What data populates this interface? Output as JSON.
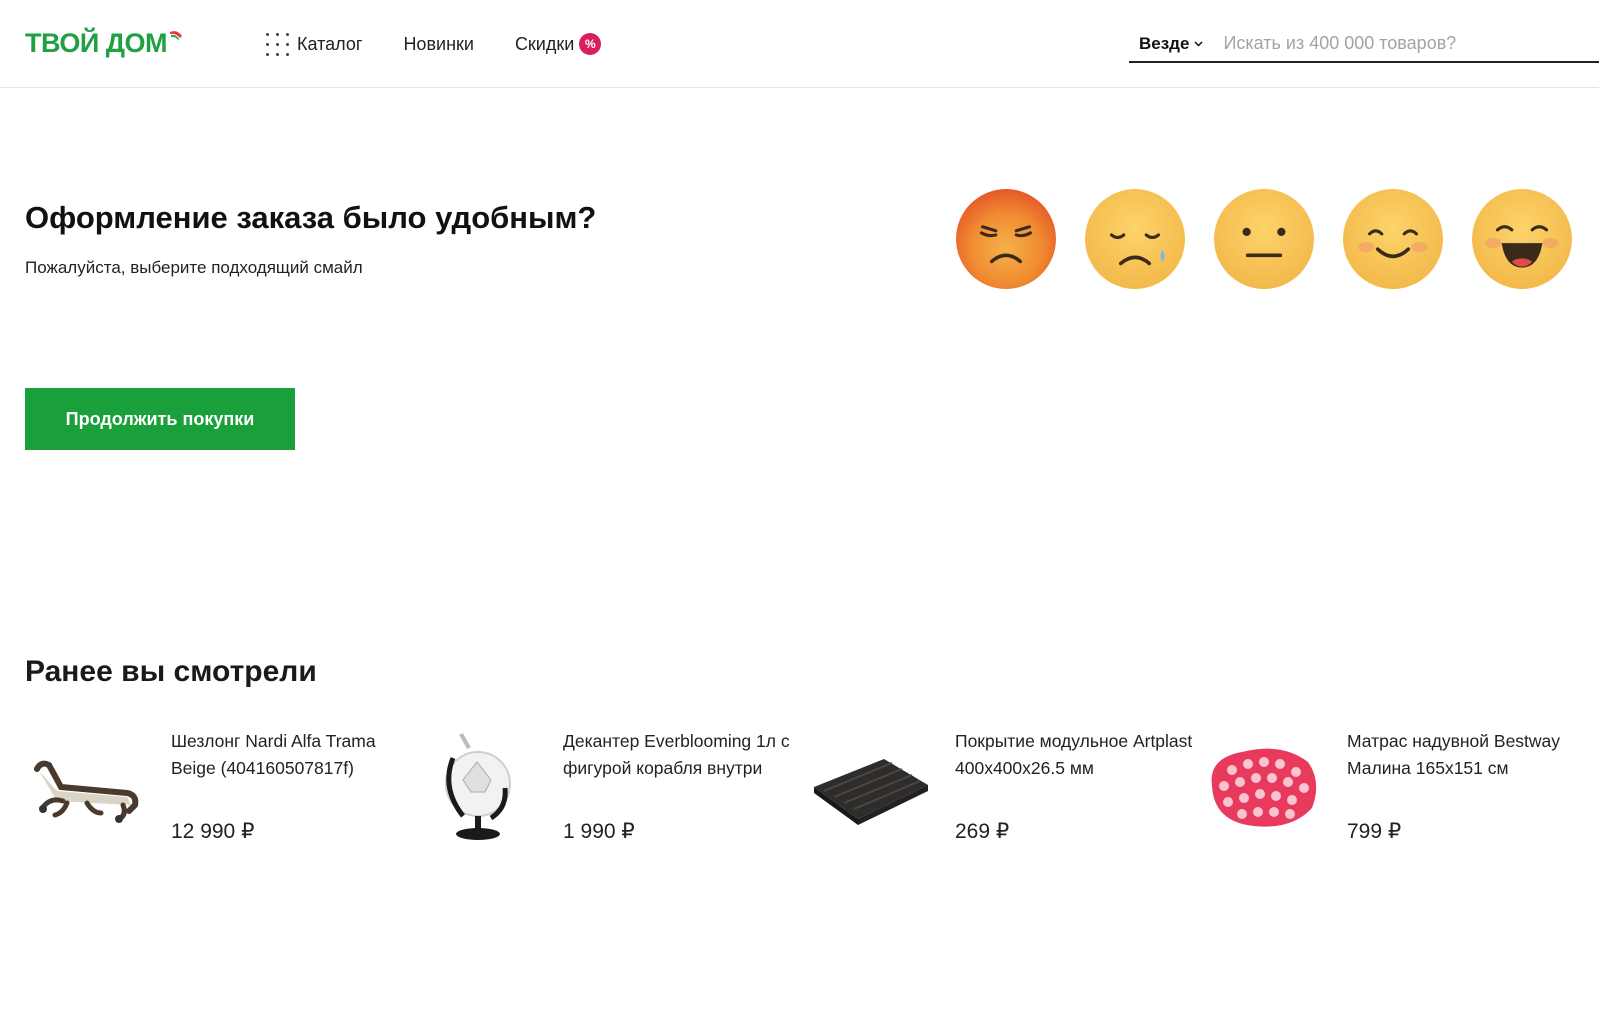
{
  "header": {
    "logo_text": "ТВОЙ ДОМ",
    "nav": {
      "catalog": "Каталог",
      "news": "Новинки",
      "sales": "Скидки",
      "sales_badge": "%"
    },
    "search": {
      "scope": "Везде",
      "placeholder": "Искать из 400 000 товаров?"
    }
  },
  "feedback": {
    "title": "Оформление заказа было удобным?",
    "subtitle": "Пожалуйста, выберите подходящий смайл",
    "smiles": [
      "angry-face-icon",
      "sad-tear-face-icon",
      "neutral-face-icon",
      "smiling-face-icon",
      "laughing-face-icon"
    ]
  },
  "continue_button": "Продолжить покупки",
  "recently_viewed": {
    "title": "Ранее вы смотрели",
    "products": [
      {
        "name": "Шезлонг Nardi Alfa Trama Beige (404160507817f)",
        "price": "12 990 ₽",
        "image": "lounger-image"
      },
      {
        "name": "Декантер Everblooming 1л с фигурой корабля внутри",
        "price": "1 990 ₽",
        "image": "globe-decanter-image"
      },
      {
        "name": "Покрытие модульное Artplast 400х400х26.5 мм",
        "price": "269 ₽",
        "image": "deck-tile-image"
      },
      {
        "name": "Матрас надувной Bestway Малина 165х151 см",
        "price": "799 ₽",
        "image": "raspberry-mattress-image"
      }
    ]
  },
  "colors": {
    "brand_green": "#1ea043",
    "button_green": "#1aa03b",
    "badge_pink": "#d81f5c"
  }
}
